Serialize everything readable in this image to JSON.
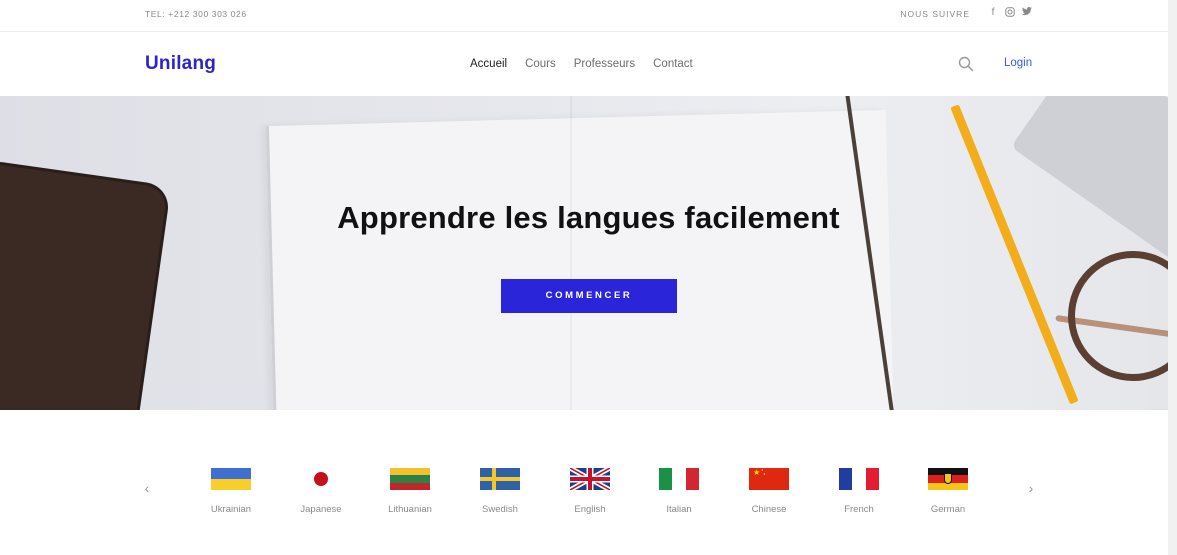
{
  "topbar": {
    "tel": "TEL:  +212 300 303 026",
    "follow_label": "NOUS SUIVRE",
    "social": [
      {
        "icon": "facebook-icon",
        "glyph": "f"
      },
      {
        "icon": "instagram-icon",
        "glyph": "◎"
      },
      {
        "icon": "twitter-icon",
        "glyph": "🐦"
      }
    ]
  },
  "navbar": {
    "brand": "Unilang",
    "links": [
      {
        "label": "Accueil",
        "active": true
      },
      {
        "label": "Cours",
        "active": false
      },
      {
        "label": "Professeurs",
        "active": false
      },
      {
        "label": "Contact",
        "active": false
      }
    ],
    "search_icon": "search-icon",
    "login_label": "Login"
  },
  "hero": {
    "title": "Apprendre les langues facilement",
    "cta_label": "COMMENCER"
  },
  "languages": {
    "prev_glyph": "‹",
    "next_glyph": "›",
    "items": [
      {
        "label": "Ukrainian",
        "flag": "ukraine-flag-icon"
      },
      {
        "label": "Japanese",
        "flag": "japan-flag-icon"
      },
      {
        "label": "Lithuanian",
        "flag": "lithuania-flag-icon"
      },
      {
        "label": "Swedish",
        "flag": "sweden-flag-icon"
      },
      {
        "label": "English",
        "flag": "uk-flag-icon"
      },
      {
        "label": "Italian",
        "flag": "italy-flag-icon"
      },
      {
        "label": "Chinese",
        "flag": "china-flag-icon"
      },
      {
        "label": "French",
        "flag": "france-flag-icon"
      },
      {
        "label": "German",
        "flag": "germany-flag-icon"
      }
    ]
  },
  "colors": {
    "brand": "#2b25c9",
    "cta": "#2b25d9",
    "login": "#3a5bd9"
  }
}
